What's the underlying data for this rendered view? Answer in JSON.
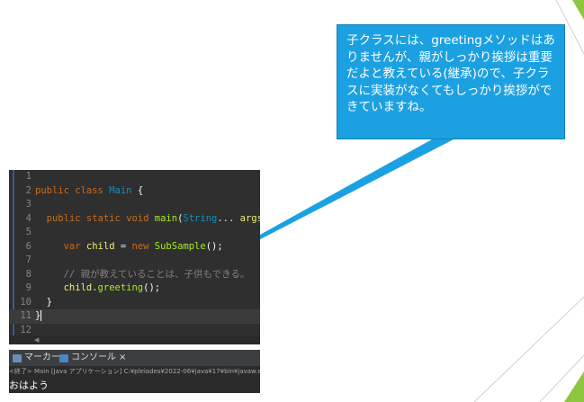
{
  "callout": {
    "text": "子クラスには、greetingメソッドはありませんが、親がしっかり挨拶は重要だよと教えている(継承)ので、子クラスに実装がなくてもしっかり挨拶ができていますね。"
  },
  "editor": {
    "lines": [
      {
        "number": "1"
      },
      {
        "number": "2",
        "kw_public": "public",
        "kw_class": "class",
        "class_name": "Main",
        "brace": "{"
      },
      {
        "number": "3"
      },
      {
        "number": "4",
        "mods": "public static void",
        "method": "main",
        "open": "(",
        "type": "String",
        "rest": "... ",
        "param": "args",
        "close": ") {"
      },
      {
        "number": "5"
      },
      {
        "number": "6",
        "kw_var": "var",
        "var_name": "child",
        "eq": " = ",
        "kw_new": "new",
        "type": "SubSample",
        "tail": "();"
      },
      {
        "number": "7"
      },
      {
        "number": "8",
        "comment": "// 親が教えていることは、子供もできる。"
      },
      {
        "number": "9",
        "obj": "child",
        "dot": ".",
        "method": "greeting",
        "tail": "();"
      },
      {
        "number": "10",
        "brace": "}"
      },
      {
        "number": "11",
        "brace": "}"
      },
      {
        "number": "12"
      }
    ]
  },
  "tabs": {
    "markers": "マーカー",
    "console": "コンソール",
    "close": "×"
  },
  "console": {
    "header": "<終了> Main [Java アプリケーション] C:¥pleiades¥2022-06¥java¥17¥bin¥javaw.exe",
    "output": "おはよう"
  },
  "colors": {
    "callout_bg": "#1ba1e2",
    "slide_accent": "#8dc63f",
    "editor_bg": "#2f2f2f"
  }
}
